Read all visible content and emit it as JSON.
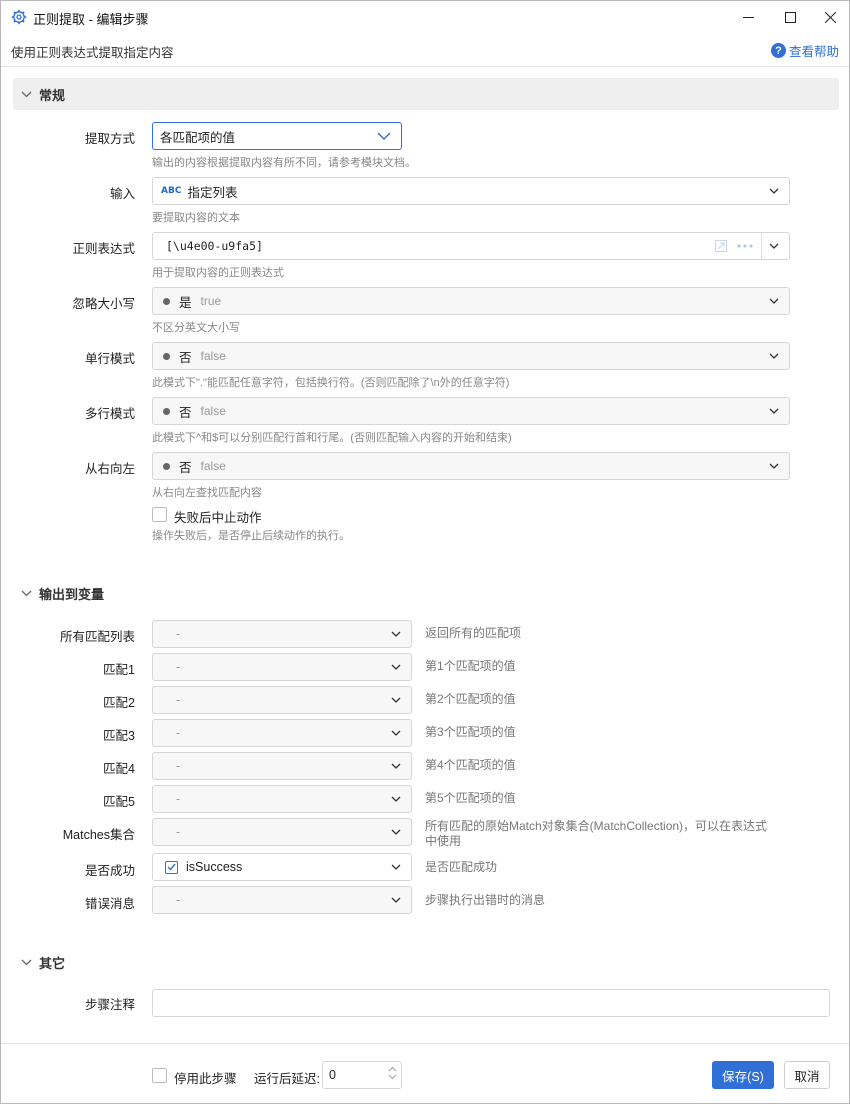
{
  "window": {
    "title": "正则提取 - 编辑步骤",
    "subtitle": "使用正则表达式提取指定内容",
    "help_label": "查看帮助"
  },
  "sections": {
    "general": "常规",
    "output": "输出到变量",
    "other": "其它"
  },
  "general": {
    "extract_mode": {
      "label": "提取方式",
      "value": "各匹配项的值",
      "hint": "输出的内容根据提取内容有所不同，请参考模块文档。"
    },
    "input": {
      "label": "输入",
      "tag": "ABC",
      "value": "指定列表",
      "hint": "要提取内容的文本"
    },
    "regex": {
      "label": "正则表达式",
      "value": "[\\u4e00-u9fa5]",
      "hint": "用于提取内容的正则表达式"
    },
    "ignore_case": {
      "label": "忽略大小写",
      "value_zh": "是",
      "value_en": "true",
      "hint": "不区分英文大小写"
    },
    "singleline": {
      "label": "单行模式",
      "value_zh": "否",
      "value_en": "false",
      "hint": "此模式下\".\"能匹配任意字符，包括换行符。(否则匹配除了\\n外的任意字符)"
    },
    "multiline": {
      "label": "多行模式",
      "value_zh": "否",
      "value_en": "false",
      "hint": "此模式下^和$可以分别匹配行首和行尾。(否则匹配输入内容的开始和结束)"
    },
    "right_to_left": {
      "label": "从右向左",
      "value_zh": "否",
      "value_en": "false",
      "hint": "从右向左查找匹配内容"
    },
    "stop_on_fail": {
      "label": "失败后中止动作",
      "hint": "操作失败后，是否停止后续动作的执行。"
    }
  },
  "outputs": [
    {
      "label": "所有匹配列表",
      "value": "-",
      "desc": "返回所有的匹配项"
    },
    {
      "label": "匹配1",
      "value": "-",
      "desc": "第1个匹配项的值"
    },
    {
      "label": "匹配2",
      "value": "-",
      "desc": "第2个匹配项的值"
    },
    {
      "label": "匹配3",
      "value": "-",
      "desc": "第3个匹配项的值"
    },
    {
      "label": "匹配4",
      "value": "-",
      "desc": "第4个匹配项的值"
    },
    {
      "label": "匹配5",
      "value": "-",
      "desc": "第5个匹配项的值"
    },
    {
      "label": "Matches集合",
      "value": "-",
      "desc": "所有匹配的原始Match对象集合(MatchCollection)，可以在表达式中使用"
    },
    {
      "label": "是否成功",
      "value": "isSuccess",
      "desc": "是否匹配成功"
    },
    {
      "label": "错误消息",
      "value": "-",
      "desc": "步骤执行出错时的消息"
    }
  ],
  "other": {
    "note_label": "步骤注释",
    "note_value": ""
  },
  "footer": {
    "disable_label": "停用此步骤",
    "delay_label": "运行后延迟:",
    "delay_value": "0",
    "save_label": "保存(S)",
    "cancel_label": "取消"
  },
  "colors": {
    "accent": "#2f6fd6"
  }
}
